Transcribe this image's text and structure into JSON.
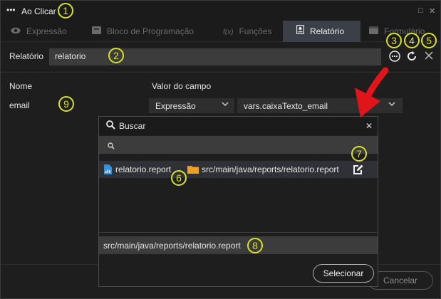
{
  "window": {
    "title": "Ao Clicar",
    "dots": "•••",
    "restore_glyph": "□",
    "close_glyph": "✕"
  },
  "tabs": [
    {
      "label": "Expressão",
      "icon": "eye-icon",
      "active": false
    },
    {
      "label": "Bloco de Programação",
      "icon": "block-icon",
      "active": false
    },
    {
      "label": "Funções",
      "icon": "function-icon",
      "active": false
    },
    {
      "label": "Relatório",
      "icon": "report-icon",
      "active": true
    },
    {
      "label": "Formulário",
      "icon": "form-icon",
      "active": false
    }
  ],
  "report": {
    "label": "Relatório",
    "value": "relatorio"
  },
  "table": {
    "col_name": "Nome",
    "col_value": "Valor do campo",
    "row": {
      "name": "email",
      "type": "Expressão",
      "value": "vars.caixaTexto_email"
    }
  },
  "popup": {
    "title": "Buscar",
    "search_placeholder": "",
    "result_file": "relatorio.report",
    "result_path": "src/main/java/reports/relatorio.report",
    "selected_path": "src/main/java/reports/relatorio.report",
    "select_label": "Selecionar",
    "close_glyph": "✕"
  },
  "footer": {
    "cancel_label": "Cancelar"
  },
  "callouts": [
    "1",
    "2",
    "3",
    "4",
    "5",
    "6",
    "7",
    "8",
    "9"
  ],
  "colors": {
    "callout": "#d8e02a",
    "arrow": "#e0151b",
    "active_tab": "#3a3f48"
  }
}
